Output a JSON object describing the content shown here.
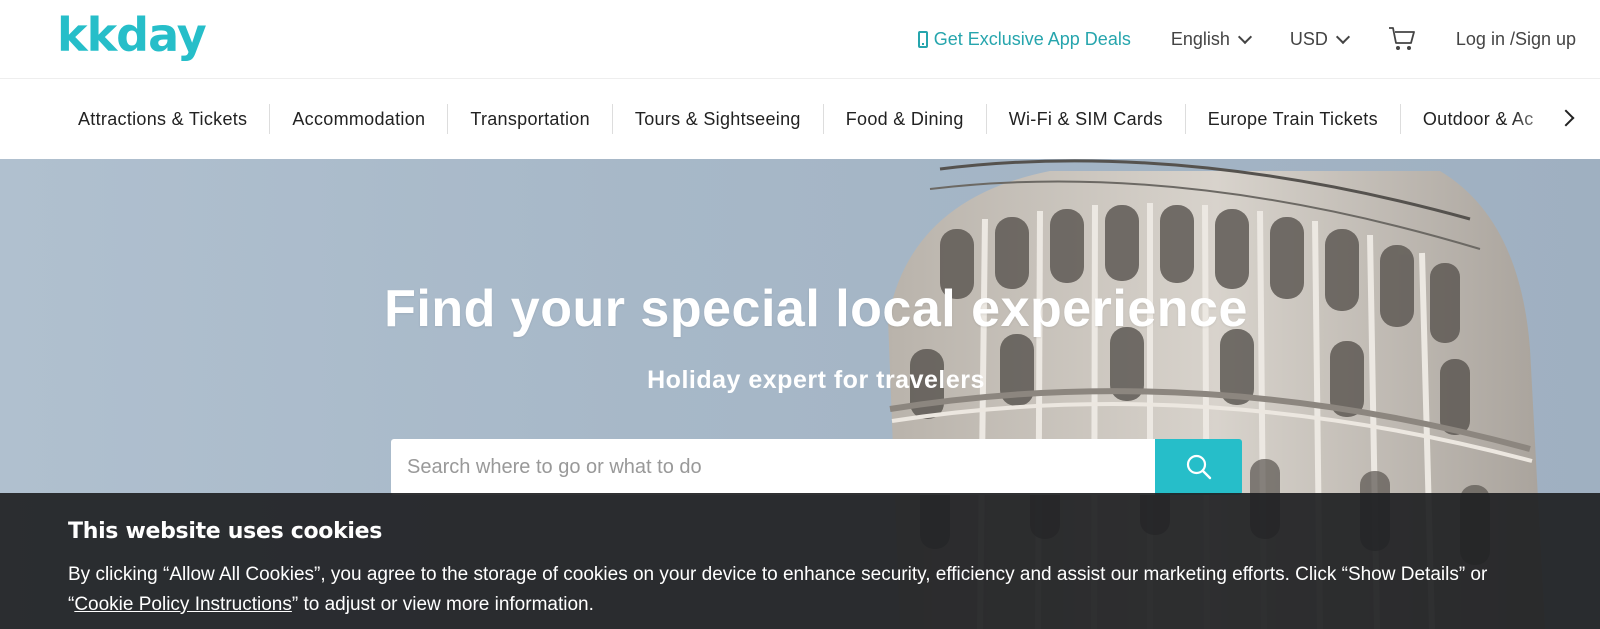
{
  "header": {
    "logo_text": "kkday",
    "app_deals_label": "Get Exclusive App Deals",
    "language_label": "English",
    "currency_label": "USD",
    "login_label": "Log in /Sign up",
    "accent_color": "#26bec9"
  },
  "categories": [
    "Attractions & Tickets",
    "Accommodation",
    "Transportation",
    "Tours & Sightseeing",
    "Food & Dining",
    "Wi-Fi & SIM Cards",
    "Europe Train Tickets",
    "Outdoor & Ac"
  ],
  "hero": {
    "title": "Find your special local experience",
    "subtitle": "Holiday expert for travelers",
    "search_placeholder": "Search where to go or what to do"
  },
  "cookie_banner": {
    "title": "This website uses cookies",
    "text_part1": "By clicking “Allow All Cookies”, you agree to the storage of cookies on your device to enhance security, efficiency and assist our marketing efforts. Click “Show Details” or “",
    "link_text": "Cookie Policy Instructions",
    "text_part2": "” to adjust or view more information."
  },
  "icons": {
    "phone": "phone-icon",
    "cart": "cart-icon",
    "search": "search-icon",
    "next": "chevron-right-icon"
  }
}
